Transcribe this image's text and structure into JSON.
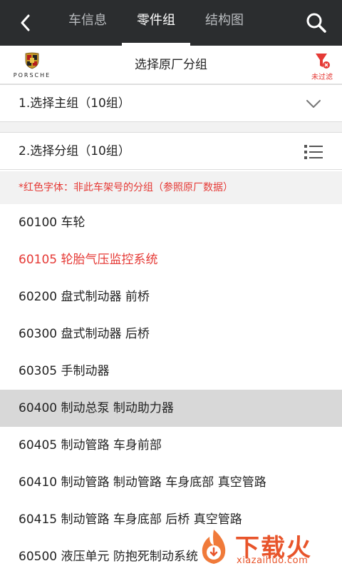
{
  "nav": {
    "tabs": [
      {
        "label": "车信息",
        "active": false
      },
      {
        "label": "零件组",
        "active": true
      },
      {
        "label": "结构图",
        "active": false
      }
    ],
    "back_icon": "chevron-left-icon",
    "search_icon": "search-icon"
  },
  "brand": {
    "logo_word": "PORSCHE",
    "title": "选择原厂分组",
    "filter_label": "未过滤",
    "filter_icon": "funnel-icon"
  },
  "steps": {
    "main_group": {
      "label": "1.选择主组（10组）",
      "icon": "chevron-down-icon"
    },
    "sub_group": {
      "label": "2.选择分组（10组）",
      "icon": "list-icon"
    }
  },
  "notice": "*红色字体：非此车架号的分组（参照原厂数据）",
  "items": [
    {
      "label": "60100 车轮",
      "red": false,
      "selected": false
    },
    {
      "label": "60105 轮胎气压监控系统",
      "red": true,
      "selected": false
    },
    {
      "label": "60200 盘式制动器 前桥",
      "red": false,
      "selected": false
    },
    {
      "label": "60300 盘式制动器 后桥",
      "red": false,
      "selected": false
    },
    {
      "label": "60305 手制动器",
      "red": false,
      "selected": false
    },
    {
      "label": "60400 制动总泵 制动助力器",
      "red": false,
      "selected": true
    },
    {
      "label": "60405 制动管路 车身前部",
      "red": false,
      "selected": false
    },
    {
      "label": "60410 制动管路 制动管路 车身底部 真空管路",
      "red": false,
      "selected": false
    },
    {
      "label": "60415 制动管路 车身底部 后桥 真空管路",
      "red": false,
      "selected": false
    },
    {
      "label": "60500 液压单元 防抱死制动系统",
      "red": false,
      "selected": false
    }
  ],
  "watermark": {
    "text": "下载火",
    "sub": "xiazaihuo.com"
  },
  "colors": {
    "accent_red": "#e53935",
    "topbar": "#2b2d2f",
    "selected_row": "#d8d8d8",
    "watermark": "#e8542a"
  }
}
